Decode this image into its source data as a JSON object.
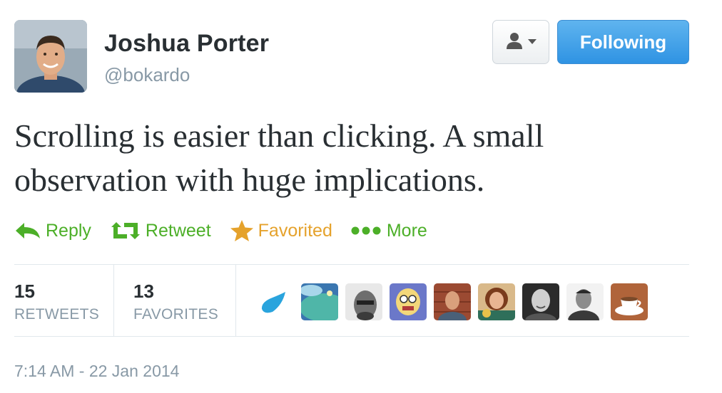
{
  "author": {
    "name": "Joshua Porter",
    "handle": "@bokardo"
  },
  "header": {
    "user_menu_icon": "user-dropdown-icon",
    "follow_button_label": "Following",
    "follow_button_color": "#2f93e3"
  },
  "tweet": {
    "text": "Scrolling is easier than clicking. A small observation with huge implications."
  },
  "actions": {
    "reply": {
      "label": "Reply",
      "icon": "reply-arrow-icon"
    },
    "retweet": {
      "label": "Retweet",
      "icon": "retweet-icon"
    },
    "favorite": {
      "label": "Favorited",
      "icon": "star-icon"
    },
    "more": {
      "label": "More",
      "icon": "ellipsis-icon"
    },
    "action_color": "#4caf28",
    "favorited_color": "#e5a22c"
  },
  "stats": {
    "retweets": {
      "count": "15",
      "label": "RETWEETS"
    },
    "favorites": {
      "count": "13",
      "label": "FAVORITES"
    }
  },
  "favoriters": [
    "raindrop-avatar",
    "landscape-avatar",
    "bald-man-avatar",
    "cartoon-avatar",
    "brick-wall-man-avatar",
    "woman-avatar",
    "smiling-man-avatar",
    "gray-shirt-man-avatar",
    "coffee-cup-avatar"
  ],
  "timestamp": "7:14 AM - 22 Jan 2014"
}
